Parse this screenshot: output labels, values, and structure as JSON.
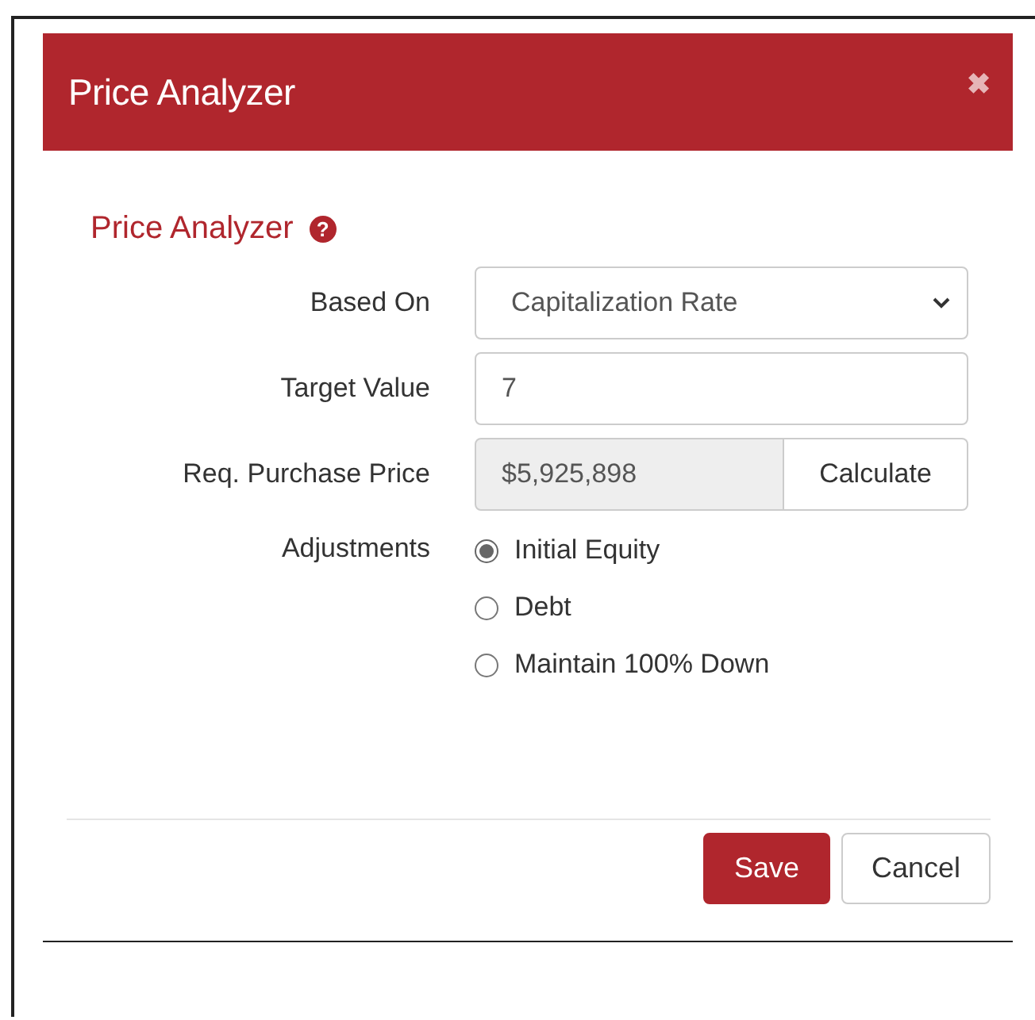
{
  "dialog": {
    "title": "Price Analyzer",
    "close": "✖"
  },
  "section": {
    "title": "Price Analyzer",
    "help": "?"
  },
  "fields": [
    {
      "kind": "select",
      "label": "Based On",
      "value": "Capitalization Rate"
    },
    {
      "kind": "input",
      "label": "Target Value",
      "value": "7"
    },
    {
      "kind": "readonly",
      "label": "Req. Purchase Price",
      "value": "$5,925,898",
      "button": "Calculate"
    }
  ],
  "adjustments": {
    "label": "Adjustments",
    "options": [
      {
        "label": "Initial Equity",
        "selected": true
      },
      {
        "label": "Debt",
        "selected": false
      },
      {
        "label": "Maintain 100% Down",
        "selected": false
      }
    ]
  },
  "buttons": [
    {
      "kind": "primary",
      "label": "Save"
    },
    {
      "kind": "default",
      "label": "Cancel"
    }
  ]
}
